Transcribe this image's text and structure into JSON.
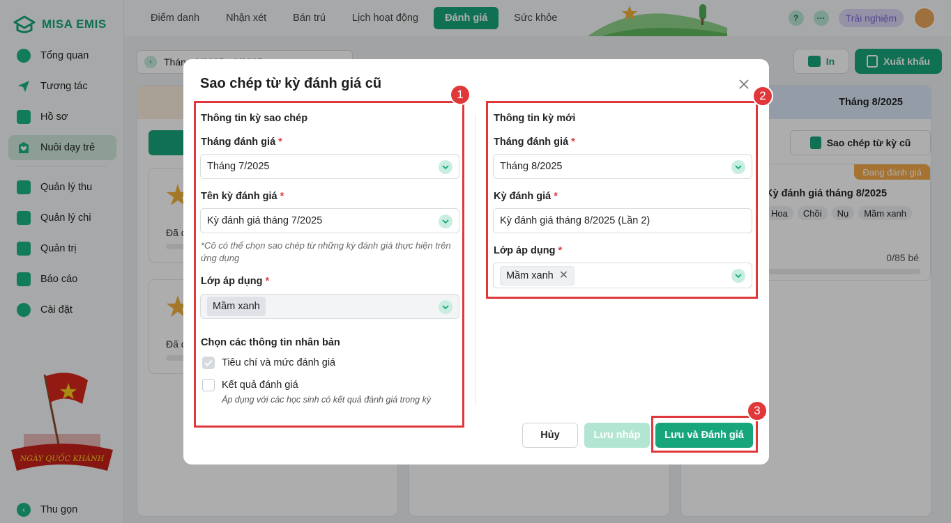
{
  "app": {
    "logo_text": "MISA EMIS"
  },
  "sidebar": {
    "items": [
      {
        "label": "Tổng quan",
        "icon": "pie-chart-icon"
      },
      {
        "label": "Tương tác",
        "icon": "send-icon"
      },
      {
        "label": "Hồ sơ",
        "icon": "folder-icon"
      },
      {
        "label": "Nuôi dạy trẻ",
        "icon": "heart-icon",
        "active": true
      },
      {
        "label": "Quản lý thu",
        "icon": "income-chart-icon"
      },
      {
        "label": "Quản lý chi",
        "icon": "wallet-icon"
      },
      {
        "label": "Quản trị",
        "icon": "briefcase-icon"
      },
      {
        "label": "Báo cáo",
        "icon": "bar-chart-icon"
      },
      {
        "label": "Cài đặt",
        "icon": "gear-icon"
      }
    ],
    "promo_text": "NGÀY QUỐC KHÁNH",
    "collapse_label": "Thu gọn"
  },
  "topbar": {
    "tabs": [
      {
        "label": "Điểm danh"
      },
      {
        "label": "Nhận xét"
      },
      {
        "label": "Bán trú"
      },
      {
        "label": "Lịch hoạt động"
      },
      {
        "label": "Đánh giá",
        "active": true
      },
      {
        "label": "Sức khỏe"
      }
    ],
    "help_icon": "?",
    "more_icon": "···",
    "trial_label": "Trải nghiệm"
  },
  "content": {
    "month_picker_text": "Tháng 8/2025 - 9/2025",
    "print_label": "In",
    "export_label": "Xuất khẩu",
    "right_column": {
      "header": "Tháng 8/2025",
      "copy_button": "Sao chép từ kỳ cũ",
      "badge": "Đang đánh giá",
      "card_title": "Kỳ đánh giá tháng 8/2025",
      "chips": [
        "Hoa",
        "Chồi",
        "Nụ",
        "Mầm xanh"
      ],
      "count": "0/85 bé"
    },
    "left_cards_status": [
      "Đã đánh giá",
      "Đã đánh giá"
    ]
  },
  "modal": {
    "title": "Sao chép từ kỳ đánh giá cũ",
    "left": {
      "section_title": "Thông tin kỳ sao chép",
      "month_label": "Tháng đánh giá",
      "month_value": "Tháng 7/2025",
      "period_label": "Tên kỳ đánh giá",
      "period_value": "Kỳ đánh giá tháng 7/2025",
      "note": "*Cô có thể chọn sao chép từ những kỳ đánh giá thực hiện trên ứng dụng",
      "class_label": "Lớp áp dụng",
      "class_tag": "Mầm xanh",
      "clone_title": "Chọn các thông tin nhân bản",
      "options": [
        {
          "label": "Tiêu chí và mức đánh giá",
          "checked": true
        },
        {
          "label": "Kết quả đánh giá",
          "checked": false
        }
      ],
      "result_note": "Áp dụng với các học sinh có kết quả đánh giá trong kỳ"
    },
    "right": {
      "section_title": "Thông tin kỳ mới",
      "month_label": "Tháng đánh giá",
      "month_value": "Tháng 8/2025",
      "period_label": "Kỳ đánh giá",
      "period_value": "Kỳ đánh giá tháng 8/2025 (Lần 2)",
      "class_label": "Lớp áp dụng",
      "class_tag": "Mầm xanh"
    },
    "required_mark": "*",
    "buttons": {
      "cancel": "Hủy",
      "draft": "Lưu nháp",
      "save": "Lưu và Đánh giá"
    },
    "step_markers": [
      "1",
      "2",
      "3"
    ]
  },
  "colors": {
    "primary": "#17a67c",
    "annotation_red": "#e0383a",
    "badge_orange": "#f3a84b",
    "trial_purple": "#7a66d8"
  }
}
